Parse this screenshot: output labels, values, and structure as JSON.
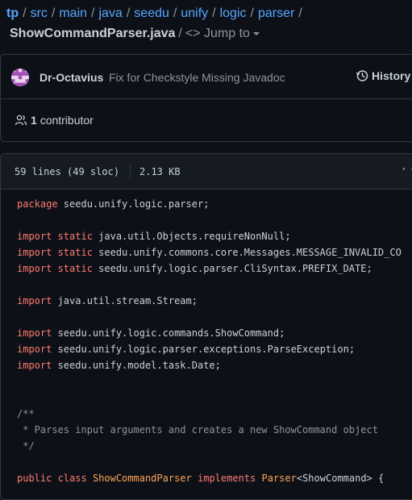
{
  "breadcrumb": {
    "repo": "tp",
    "path": [
      "src",
      "main",
      "java",
      "seedu",
      "unify",
      "logic",
      "parser"
    ],
    "separator": "/",
    "file": "ShowCommandParser.java",
    "jump_label": "Jump to"
  },
  "commit": {
    "author": "Dr-Octavius",
    "message": "Fix for Checkstyle Missing Javadoc",
    "history_label": "History"
  },
  "contributors": {
    "count": "1",
    "label": "contributor"
  },
  "file_header": {
    "lines": "59 lines (49 sloc)",
    "size": "2.13 KB",
    "more": "···"
  },
  "code": [
    {
      "k": "package",
      "t": " seedu.unify.logic.parser;"
    },
    {
      "t": ""
    },
    {
      "k": "import static",
      "t": " java.util.Objects.requireNonNull;"
    },
    {
      "k": "import static",
      "t": " seedu.unify.commons.core.Messages.MESSAGE_INVALID_CO"
    },
    {
      "k": "import static",
      "t": " seedu.unify.logic.parser.CliSyntax.PREFIX_DATE;"
    },
    {
      "t": ""
    },
    {
      "k": "import",
      "t": " java.util.stream.Stream;"
    },
    {
      "t": ""
    },
    {
      "k": "import",
      "t": " seedu.unify.logic.commands.ShowCommand;"
    },
    {
      "k": "import",
      "t": " seedu.unify.logic.parser.exceptions.ParseException;"
    },
    {
      "k": "import",
      "t": " seedu.unify.model.task.Date;"
    },
    {
      "t": ""
    },
    {
      "t": ""
    },
    {
      "c": "/**"
    },
    {
      "c": " * Parses input arguments and creates a new ShowCommand object"
    },
    {
      "c": " */"
    },
    {
      "t": ""
    },
    {
      "k": "public class",
      "cls": "ShowCommandParser",
      "k2": "implements",
      "cls2": "Parser",
      "t": "<ShowCommand> {"
    }
  ],
  "colors": {
    "link": "#58a6ff",
    "keyword": "#ff7b72",
    "comment": "#8b949e",
    "class": "#ffa657",
    "background": "#0d1117"
  },
  "icons": {
    "history": "clock-icon",
    "contributors": "people-icon",
    "avatar": "identicon-avatar"
  }
}
